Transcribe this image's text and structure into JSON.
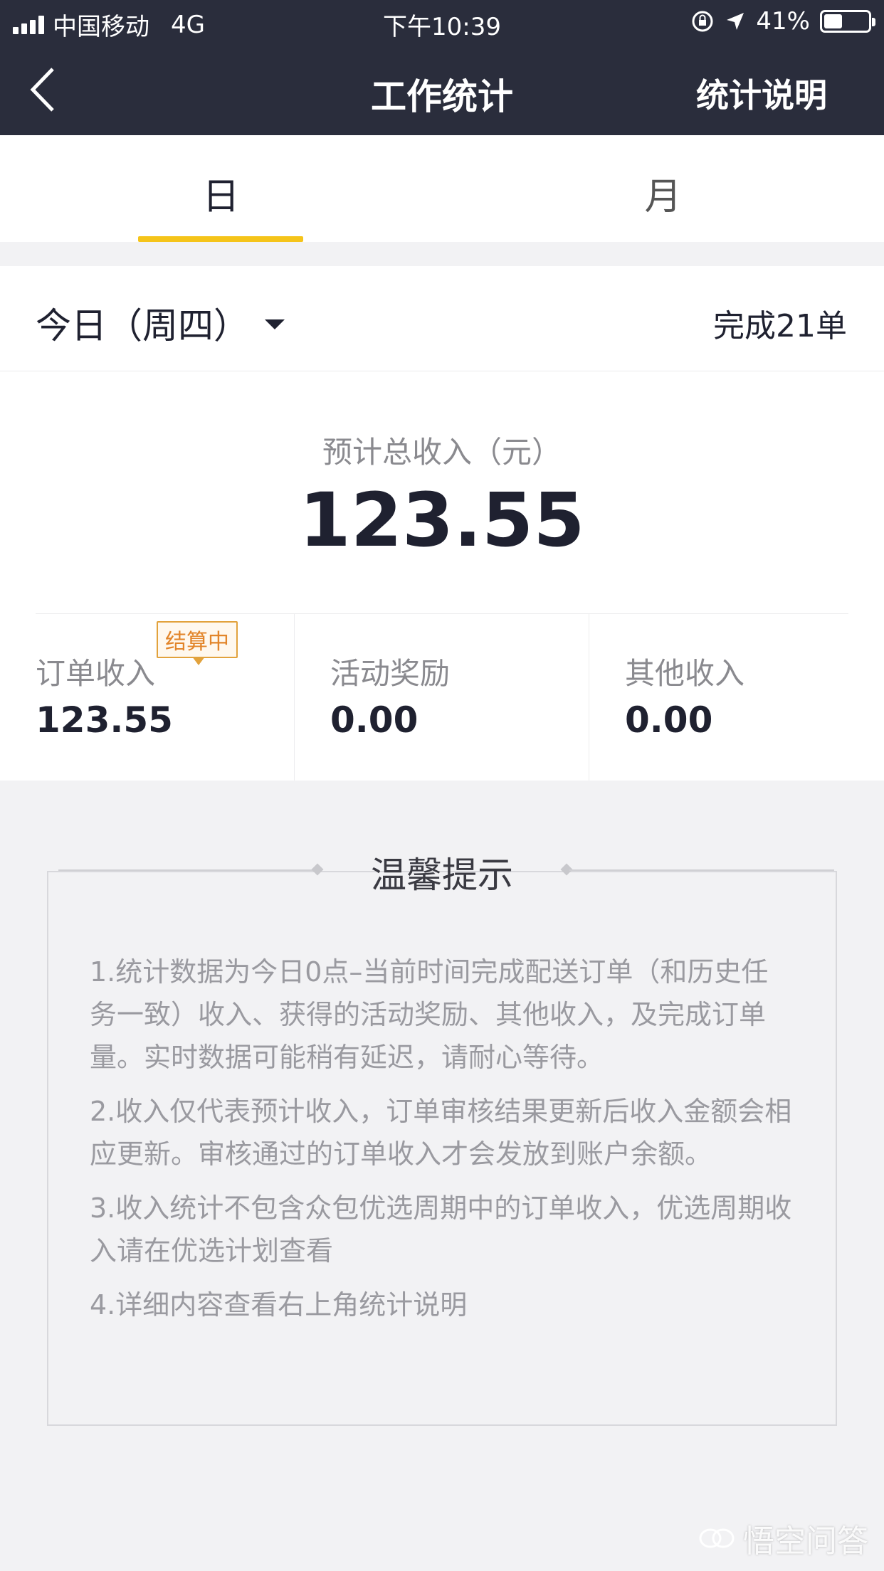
{
  "status_bar": {
    "carrier": "中国移动",
    "network": "4G",
    "time": "下午10:39",
    "battery": "41%",
    "battery_level": 0.41
  },
  "navbar": {
    "title": "工作统计",
    "right_action": "统计说明",
    "icons": {
      "back": "chevron-left-icon"
    }
  },
  "tabs": [
    {
      "label": "日",
      "active": true
    },
    {
      "label": "月",
      "active": false
    }
  ],
  "date_row": {
    "selected": "今日（周四）",
    "completed": "完成21单"
  },
  "summary": {
    "total_label": "预计总收入（元）",
    "total_value": "123.55",
    "badge": "结算中",
    "columns": [
      {
        "label": "订单收入",
        "value": "123.55"
      },
      {
        "label": "活动奖励",
        "value": "0.00"
      },
      {
        "label": "其他收入",
        "value": "0.00"
      }
    ]
  },
  "tips": {
    "title": "温馨提示",
    "items": [
      "1.统计数据为今日0点–当前时间完成配送订单（和历史任务一致）收入、获得的活动奖励、其他收入，及完成订单量。实时数据可能稍有延迟，请耐心等待。",
      "2.收入仅代表预计收入，订单审核结果更新后收入金额会相应更新。审核通过的订单收入才会发放到账户余额。",
      "3.收入统计不包含众包优选周期中的订单收入，优选周期收入请在优选计划查看",
      "4.详细内容查看右上角统计说明"
    ]
  },
  "watermark": {
    "text": "悟空问答"
  },
  "colors": {
    "header_bg": "#2a2d3c",
    "accent": "#f5c41a",
    "badge": "#e2852a"
  }
}
